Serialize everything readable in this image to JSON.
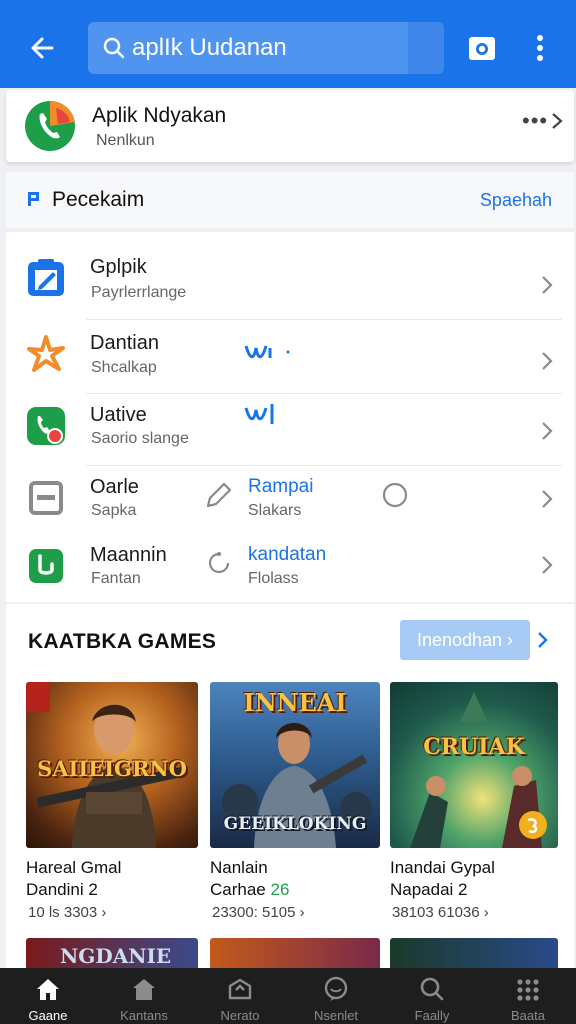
{
  "header": {
    "search_query": "aplIk Uudanan",
    "back_icon": "arrow-left-icon",
    "camera_icon": "camera-icon",
    "more_icon": "more-vertical-icon"
  },
  "app": {
    "name": "Aplik Ndyakan",
    "subtitle": "Nenlkun",
    "more": "•••"
  },
  "section": {
    "title": "Pecekaim",
    "link": "Spaehah"
  },
  "list": [
    {
      "title": "Gplpik",
      "subtitle": "Payrlerrlange"
    },
    {
      "title": "Dantian",
      "subtitle": "Shcalkap"
    },
    {
      "title": "Uative",
      "subtitle": "Saorio slange"
    },
    {
      "title": "Oarle",
      "subtitle": "Sapka",
      "second_title": "Rampai",
      "second_sub": "Slakars"
    },
    {
      "title": "Maannin",
      "subtitle": "Fantan",
      "second_title": "kandatan",
      "second_sub": "Flolass"
    }
  ],
  "games": {
    "title": "KAATBKA GAMES",
    "button": "Inenodhan ›",
    "cards": [
      {
        "art_title": "SAIIEIGRNO",
        "line1": "Hareal Gmal",
        "line2": "Dandini 2",
        "meta": "10 ls 3303 ›"
      },
      {
        "art_title_top": "INNEAI",
        "art_title": "GEEIKLOKING",
        "line1": "Nanlain",
        "line2": "Carhae",
        "line2_accent": "26",
        "meta": "23300: 5105 ›"
      },
      {
        "art_title": "CRUIAK",
        "line1": "Inandai Gypal",
        "line2": "Napadai 2",
        "meta": "38103 61036 ›"
      }
    ],
    "peek_title": "NGDANIE"
  },
  "nav": [
    {
      "label": "Gaane",
      "icon": "home-icon",
      "active": true
    },
    {
      "label": "Kantans",
      "icon": "store-icon",
      "active": false
    },
    {
      "label": "Nerato",
      "icon": "apps-icon",
      "active": false
    },
    {
      "label": "Nsenlet",
      "icon": "chat-icon",
      "active": false
    },
    {
      "label": "Faally",
      "icon": "search-icon",
      "active": false
    },
    {
      "label": "Baata",
      "icon": "grid-icon",
      "active": false
    }
  ],
  "colors": {
    "primary": "#1a73e8",
    "nav_bg": "#1e1e1e"
  }
}
